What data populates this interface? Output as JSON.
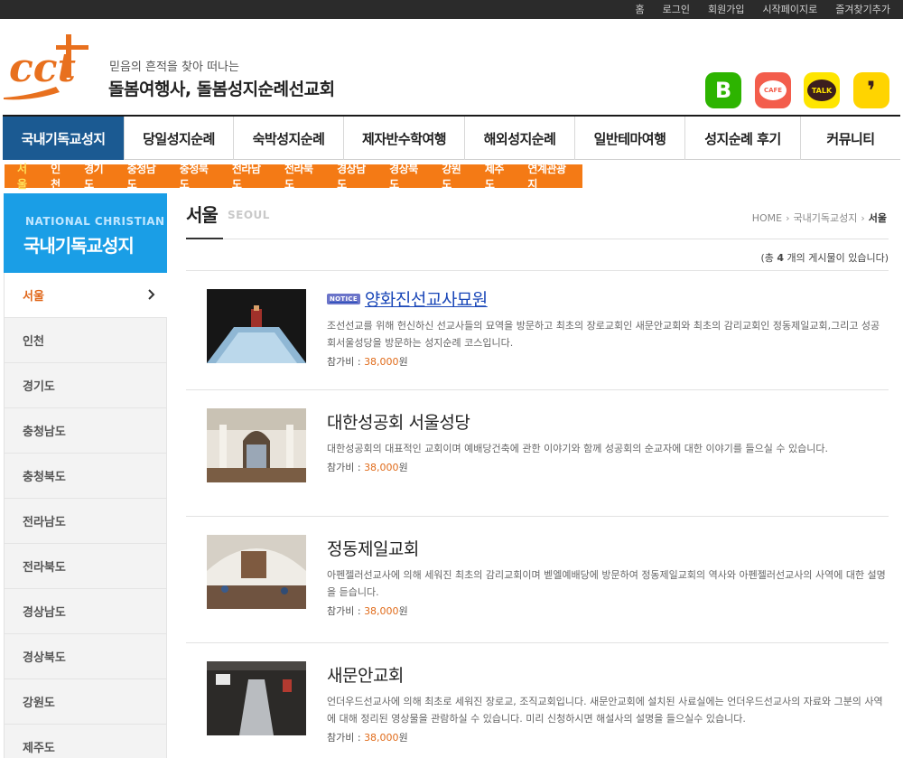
{
  "topbar": {
    "links": [
      "홈",
      "로그인",
      "회원가입",
      "시작페이지로",
      "즐겨찾기추가"
    ]
  },
  "header": {
    "logo_text": "cct",
    "tagline": "믿음의 흔적을 찾아 떠나는",
    "site_name": "돌봄여행사, 돌봄성지순례선교회",
    "sns": [
      {
        "icon": "blog-icon",
        "label": "B",
        "color": "#2db400"
      },
      {
        "icon": "cafe-icon",
        "label": "CAFE",
        "color": "#f35d4c"
      },
      {
        "icon": "kakaotalk-icon",
        "label": "TALK",
        "color": "#fee500"
      },
      {
        "icon": "kakaostory-icon",
        "label": "❜",
        "color": "#ffd400"
      }
    ]
  },
  "main_nav": {
    "items": [
      "국내기독교성지",
      "당일성지순례",
      "숙박성지순례",
      "제자반수학여행",
      "해외성지순례",
      "일반테마여행",
      "성지순례 후기",
      "커뮤니티"
    ],
    "active_index": 0
  },
  "sub_nav": {
    "items": [
      "서울",
      "인천",
      "경기도",
      "충청남도",
      "충청북도",
      "전라남도",
      "전라북도",
      "경상남도",
      "경상북도",
      "강원도",
      "제주도",
      "연계관광지"
    ],
    "active_index": 0
  },
  "sidebar": {
    "title_en": "NATIONAL CHRISTIAN",
    "title_ko": "국내기독교성지",
    "items": [
      "서울",
      "인천",
      "경기도",
      "충청남도",
      "충청북도",
      "전라남도",
      "전라북도",
      "경상남도",
      "경상북도",
      "강원도",
      "제주도"
    ],
    "active_index": 0
  },
  "content": {
    "title": "서울",
    "subtitle": "SEOUL",
    "breadcrumb": [
      "HOME",
      "국내기독교성지",
      "서울"
    ],
    "total_prefix": "(총",
    "total_count": "4",
    "total_suffix": "개의 게시물이 있습니다)",
    "notice_label": "NOTICE",
    "price_label": "참가비 :",
    "price_unit": "원",
    "items": [
      {
        "title": "양화진선교사묘원",
        "notice": true,
        "desc": "조선선교를 위해 헌신하신 선교사들의 묘역을 방문하고 최초의 장로교회인 새문안교회와 최초의 감리교회인 정동제일교회,그리고 성공회서울성당을 방문하는 성지순례 코스입니다.",
        "price": "38,000"
      },
      {
        "title": "대한성공회 서울성당",
        "notice": false,
        "desc": "대한성공회의 대표적인 교회이며 예배당건축에 관한 이야기와 함께 성공회의 순교자에 대한 이야기를 들으실 수 있습니다.",
        "price": "38,000"
      },
      {
        "title": "정동제일교회",
        "notice": false,
        "desc": "아펜젤러선교사에 의해 세워진 최초의 감리교회이며 벧엘예배당에 방문하여 정동제일교회의 역사와 아펜젤러선교사의 사역에 대한 설명을 듣습니다.",
        "price": "38,000"
      },
      {
        "title": "새문안교회",
        "notice": false,
        "desc": "언더우드선교사에 의해 최초로 세워진 장로교, 조직교회입니다. 새문안교회에 설치된 사료실에는 언더우드선교사의 자료와 그분의 사역에 대해 정리된 영상물을 관람하실 수 있습니다. 미리 신청하시면 해설사의 설명을 들으실수 있습니다.",
        "price": "38,000"
      }
    ]
  }
}
